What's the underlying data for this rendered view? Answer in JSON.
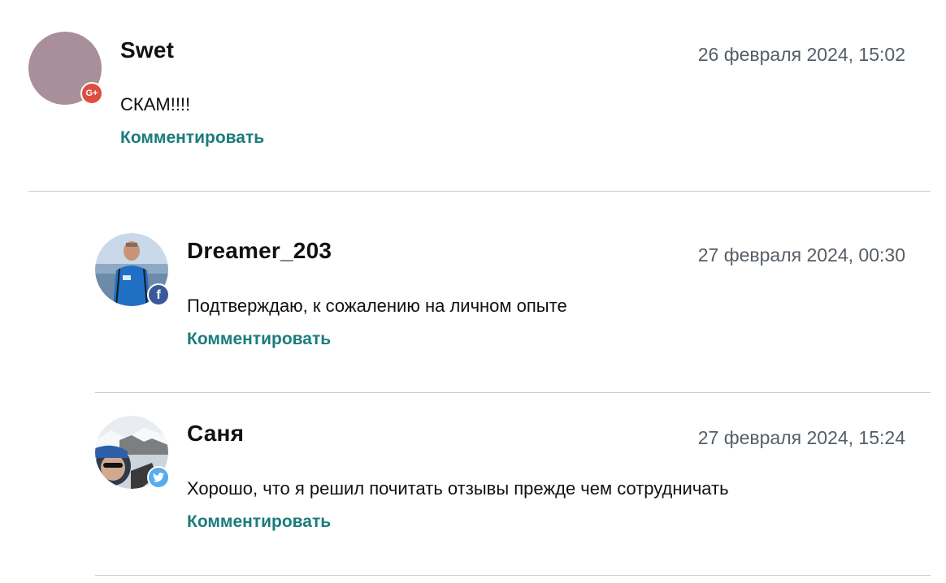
{
  "comments": [
    {
      "author": "Swet",
      "date": "26 февраля 2024, 15:02",
      "text": "СКАМ!!!!",
      "reply_label": "Комментировать",
      "social": "google-plus",
      "badge_glyph": "G+",
      "avatar_color": "#a88f9a"
    },
    {
      "author": "Dreamer_203",
      "date": "27 февраля 2024, 00:30",
      "text": "Подтверждаю, к сожалению на личном опыте",
      "reply_label": "Комментировать",
      "social": "facebook",
      "badge_glyph": "f"
    },
    {
      "author": "Саня",
      "date": "27 февраля 2024, 15:24",
      "text": "Хорошо, что я решил почитать отзывы прежде чем сотрудничать",
      "reply_label": "Комментировать",
      "social": "twitter"
    }
  ],
  "colors": {
    "link": "#1b7c7d",
    "date": "#555e66",
    "divider": "#cccccc",
    "google_plus": "#dc4e41",
    "facebook": "#3b5998",
    "twitter": "#55acee"
  }
}
